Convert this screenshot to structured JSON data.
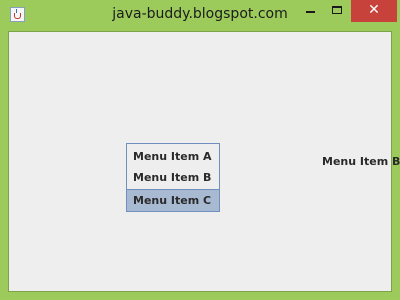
{
  "window": {
    "title": "java-buddy.blogspot.com",
    "frame_color": "#9ccb5c",
    "close_color": "#c7423a",
    "icons": {
      "app": "java-coffee-cup-icon",
      "minimize": "minimize-icon",
      "maximize": "maximize-icon",
      "close": "close-icon"
    },
    "close_glyph": "✕"
  },
  "popup_menu": {
    "items": [
      {
        "label": "Menu Item A",
        "selected": false
      },
      {
        "label": "Menu Item B",
        "selected": false
      },
      {
        "label": "Menu Item C",
        "selected": true
      }
    ],
    "selected_color": "#a8b9d2"
  },
  "content": {
    "label": "Menu Item B"
  }
}
